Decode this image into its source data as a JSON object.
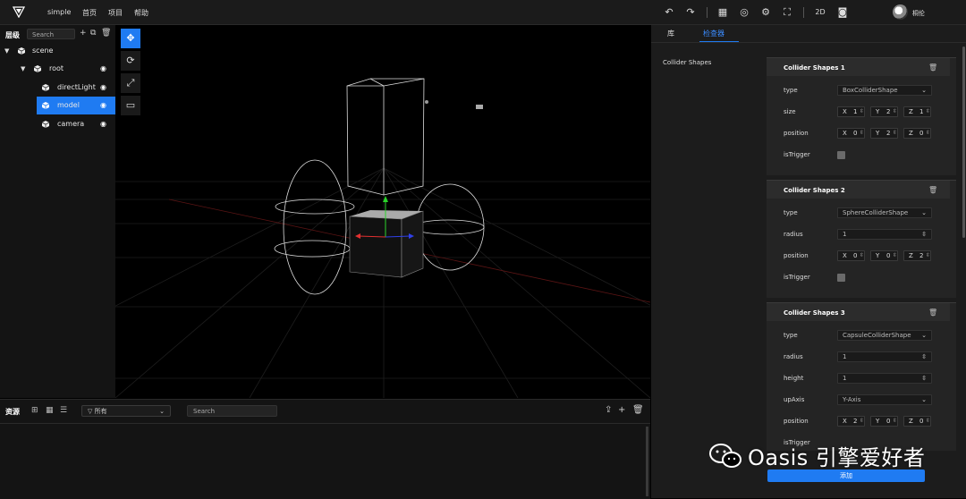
{
  "topbar": {
    "app_name": "simple",
    "menu": [
      "首页",
      "项目",
      "帮助"
    ],
    "mode_2d": "2D",
    "username": "桐伦"
  },
  "hierarchy": {
    "title": "层级",
    "search_placeholder": "Search",
    "nodes": [
      {
        "label": "scene"
      },
      {
        "label": "root"
      },
      {
        "label": "directLight"
      },
      {
        "label": "model"
      },
      {
        "label": "camera"
      }
    ]
  },
  "assets": {
    "title": "资源",
    "filter_value": "所有",
    "search_placeholder": "Search"
  },
  "right_panel": {
    "tabs": [
      "库",
      "检查器"
    ],
    "active_tab": "检查器",
    "component_label": "Collider Shapes",
    "shapes": [
      {
        "title": "Collider Shapes 1",
        "type_label": "type",
        "type_value": "BoxColliderShape",
        "size_label": "size",
        "size": [
          {
            "axis": "X",
            "value": "1"
          },
          {
            "axis": "Y",
            "value": "2"
          },
          {
            "axis": "Z",
            "value": "1"
          }
        ],
        "position_label": "position",
        "position": [
          {
            "axis": "X",
            "value": "0"
          },
          {
            "axis": "Y",
            "value": "2"
          },
          {
            "axis": "Z",
            "value": "0"
          }
        ],
        "trigger_label": "isTrigger"
      },
      {
        "title": "Collider Shapes 2",
        "type_label": "type",
        "type_value": "SphereColliderShape",
        "radius_label": "radius",
        "radius_value": "1",
        "position_label": "position",
        "position": [
          {
            "axis": "X",
            "value": "0"
          },
          {
            "axis": "Y",
            "value": "0"
          },
          {
            "axis": "Z",
            "value": "2"
          }
        ],
        "trigger_label": "isTrigger"
      },
      {
        "title": "Collider Shapes 3",
        "type_label": "type",
        "type_value": "CapsuleColliderShape",
        "radius_label": "radius",
        "radius_value": "1",
        "height_label": "height",
        "height_value": "1",
        "upaxis_label": "upAxis",
        "upaxis_value": "Y-Axis",
        "position_label": "position",
        "position": [
          {
            "axis": "X",
            "value": "2"
          },
          {
            "axis": "Y",
            "value": "0"
          },
          {
            "axis": "Z",
            "value": "0"
          }
        ],
        "trigger_label": "isTrigger"
      }
    ],
    "add_button": "添加"
  },
  "watermark": "Oasis 引擎爱好者",
  "colors": {
    "accent": "#1f7bf2",
    "background": "#000000",
    "panel": "#1c1c1c"
  }
}
